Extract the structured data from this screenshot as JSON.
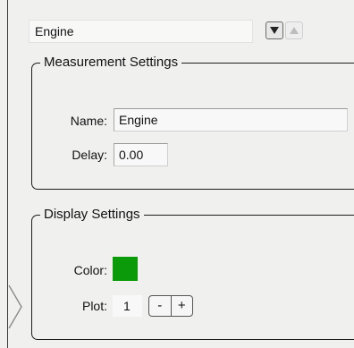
{
  "header": {
    "selected_measurement": "Engine",
    "nav": {
      "next_icon": "triangle-down-icon",
      "previous_icon": "triangle-up-icon",
      "previous_enabled": false
    }
  },
  "measurement_settings": {
    "title": "Measurement Settings",
    "name_label": "Name:",
    "name_value": "Engine",
    "delay_label": "Delay:",
    "delay_value": "0.00"
  },
  "display_settings": {
    "title": "Display Settings",
    "color_label": "Color:",
    "color_value": "#0a9a0a",
    "plot_label": "Plot:",
    "plot_value": "1",
    "decrement_label": "-",
    "increment_label": "+"
  },
  "panel": {
    "expand_icon": "chevron-right-icon"
  }
}
